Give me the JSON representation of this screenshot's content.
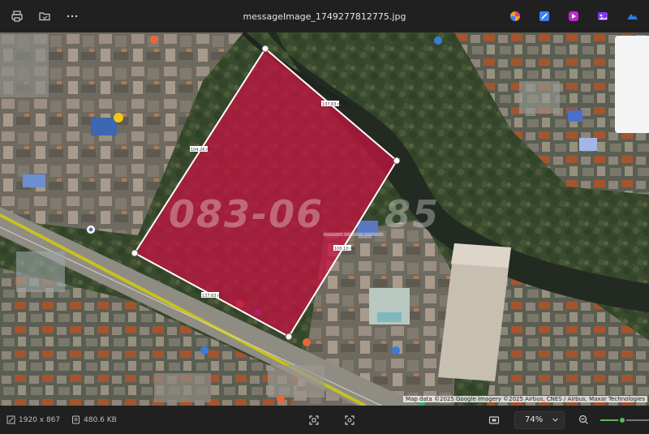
{
  "window": {
    "title": "messageImage_1749277812775.jpg"
  },
  "toolbar": {
    "left_icons": [
      "print-icon",
      "open-folder-icon",
      "more-options-icon"
    ],
    "right_apps": [
      {
        "name": "copilot-icon",
        "color": "#d9408f"
      },
      {
        "name": "designer-icon",
        "color": "#3b82f6"
      },
      {
        "name": "clipchamp-icon",
        "color": "#c026d3"
      },
      {
        "name": "photos-app-icon",
        "color": "#7c3aed"
      },
      {
        "name": "photos-cloud-icon",
        "color": "#2b7de9"
      }
    ]
  },
  "image": {
    "parcel_fill_color": "#c0153f",
    "parcel_outline_color": "#ffffff",
    "watermark_text": "083-06___85",
    "parcel_labels": [
      "137.63 m",
      "104.26 m",
      "137.63 m",
      "100.10 m"
    ],
    "attribution": "Map data ©2025 Google  Imagery ©2025 Airbus, CNES / Airbus, Maxar Technologies"
  },
  "statusbar": {
    "dimensions": "1920 x 867",
    "file_size": "480.6 KB",
    "zoom_value": "74%",
    "zoom_fraction": 0.45
  }
}
